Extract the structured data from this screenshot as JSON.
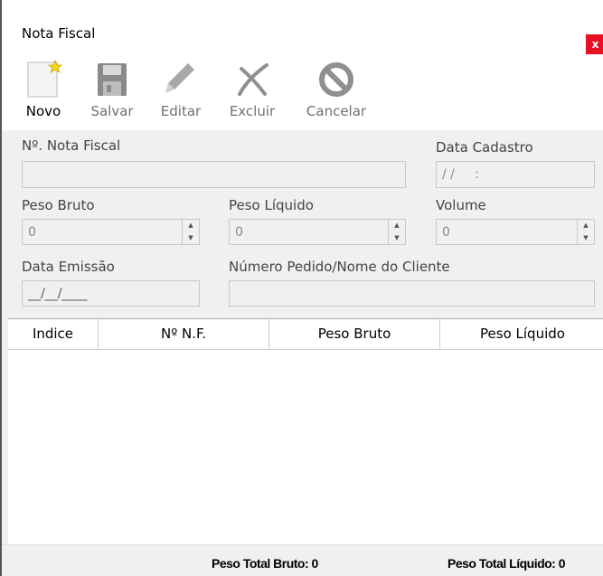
{
  "window": {
    "title": "Nota Fiscal",
    "close_label": "x",
    "close_color": "#e81123"
  },
  "toolbar": {
    "buttons": [
      {
        "label": "Novo",
        "icon": "new-document-icon",
        "enabled": true
      },
      {
        "label": "Salvar",
        "icon": "floppy-disk-icon",
        "enabled": false
      },
      {
        "label": "Editar",
        "icon": "pencil-icon",
        "enabled": false
      },
      {
        "label": "Excluir",
        "icon": "delete-x-icon",
        "enabled": false
      },
      {
        "label": "Cancelar",
        "icon": "cancel-icon",
        "enabled": false
      }
    ]
  },
  "form": {
    "nota_fiscal": {
      "label": "Nº. Nota Fiscal",
      "value": ""
    },
    "data_cadastro": {
      "label": "Data Cadastro",
      "value": "/ /     :"
    },
    "peso_bruto": {
      "label": "Peso Bruto",
      "value": "0"
    },
    "peso_liquido": {
      "label": "Peso Líquido",
      "value": "0"
    },
    "volume": {
      "label": "Volume",
      "value": "0"
    },
    "data_emissao": {
      "label": "Data Emissão",
      "value": "__/__/____"
    },
    "pedido_cliente": {
      "label": "Número Pedido/Nome do Cliente",
      "value": ""
    }
  },
  "grid": {
    "columns": [
      "Indice",
      "Nº N.F.",
      "Peso Bruto",
      "Peso Líquido"
    ],
    "rows": []
  },
  "footer": {
    "peso_total_bruto": "Peso Total Bruto: 0",
    "peso_total_liquido": "Peso Total Líquido: 0"
  }
}
